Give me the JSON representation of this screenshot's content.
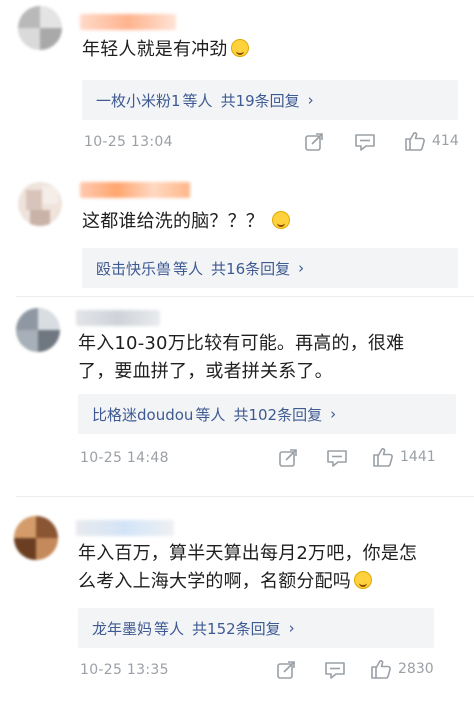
{
  "comments": [
    {
      "text": "年轻人就是有冲劲",
      "emoji": "smile-emoji",
      "replies": {
        "who": "一枚小米粉1",
        "mid": "等人",
        "count": "共19条回复",
        "arrow": "›"
      },
      "time": "10-25 13:04",
      "likes": "414"
    },
    {
      "text": "这都谁给洗的脑？？？",
      "emoji": "laugh-cry-emoji",
      "replies": {
        "who": "殴击快乐兽",
        "mid": "等人",
        "count": "共16条回复",
        "arrow": "›"
      },
      "time": "",
      "likes": ""
    },
    {
      "text_line1": "年入10-30万比较有可能。再高的，很难",
      "text_line2": "了，要血拼了，或者拼关系了。",
      "replies": {
        "who": "比格迷doudou",
        "mid": "等人",
        "count": "共102条回复",
        "arrow": "›"
      },
      "time": "10-25 14:48",
      "likes": "1441"
    },
    {
      "text_line1": "年入百万，算半天算出每月2万吧，你是怎",
      "text_line2": "么考入上海大学的啊，名额分配吗",
      "emoji": "laugh-cry-emoji",
      "replies": {
        "who": "龙年墨妈",
        "mid": "等人",
        "count": "共152条回复",
        "arrow": "›"
      },
      "time": "10-25 13:35",
      "likes": "2830"
    }
  ],
  "colors": {
    "link": "#3e5a92",
    "meta": "#9aa0a6",
    "reply_bg": "#f3f4f6"
  }
}
